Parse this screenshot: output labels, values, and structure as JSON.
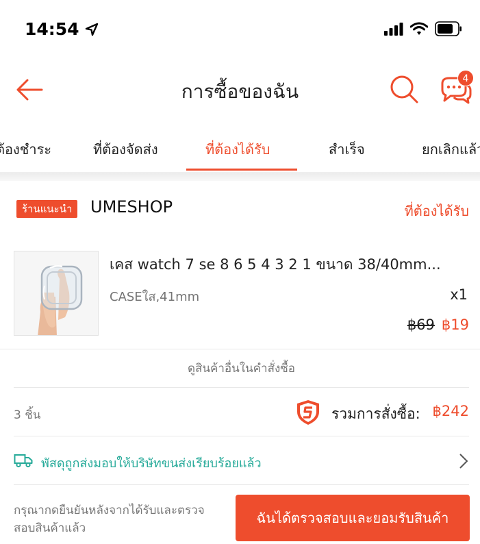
{
  "status_bar": {
    "time": "14:54"
  },
  "header": {
    "title": "การซื้อของฉัน",
    "chat_badge": "4"
  },
  "tabs": [
    {
      "label": "ต้องชำระ"
    },
    {
      "label": "ที่ต้องจัดส่ง"
    },
    {
      "label": "ที่ต้องได้รับ"
    },
    {
      "label": "สำเร็จ"
    },
    {
      "label": "ยกเลิกแล้ว"
    }
  ],
  "active_tab_index": 2,
  "order": {
    "shop_badge": "ร้านแนะนำ",
    "shop_name": "UMESHOP",
    "status": "ที่ต้องได้รับ",
    "product": {
      "title": "เคส watch 7 se 8 6 5 4 3 2 1 ขนาด 38/40mm...",
      "variant": "CASEใส,41mm",
      "qty": "x1",
      "price_original": "฿69",
      "price_sale": "฿19"
    },
    "more_link": "ดูสินค้าอื่นในคำสั่งซื้อ",
    "item_count": "3 ชิ้น",
    "total_label": "รวมการสั่งซื้อ:",
    "total_amount": "฿242",
    "shipping_status": "พัสดุถูกส่งมอบให้บริษัทขนส่งเรียบร้อยแล้ว",
    "confirm_hint": "กรุณากดยืนยันหลังจากได้รับและตรวจสอบสินค้าแล้ว",
    "confirm_button": "ฉันได้ตรวจสอบและยอมรับสินค้า"
  },
  "colors": {
    "accent": "#ee4d2d",
    "shipping": "#26aa99"
  },
  "icons": [
    "location-arrow-icon",
    "signal-icon",
    "wifi-icon",
    "battery-icon",
    "back-arrow-icon",
    "search-icon",
    "chat-icon",
    "shield-icon",
    "truck-icon",
    "chevron-right-icon"
  ]
}
